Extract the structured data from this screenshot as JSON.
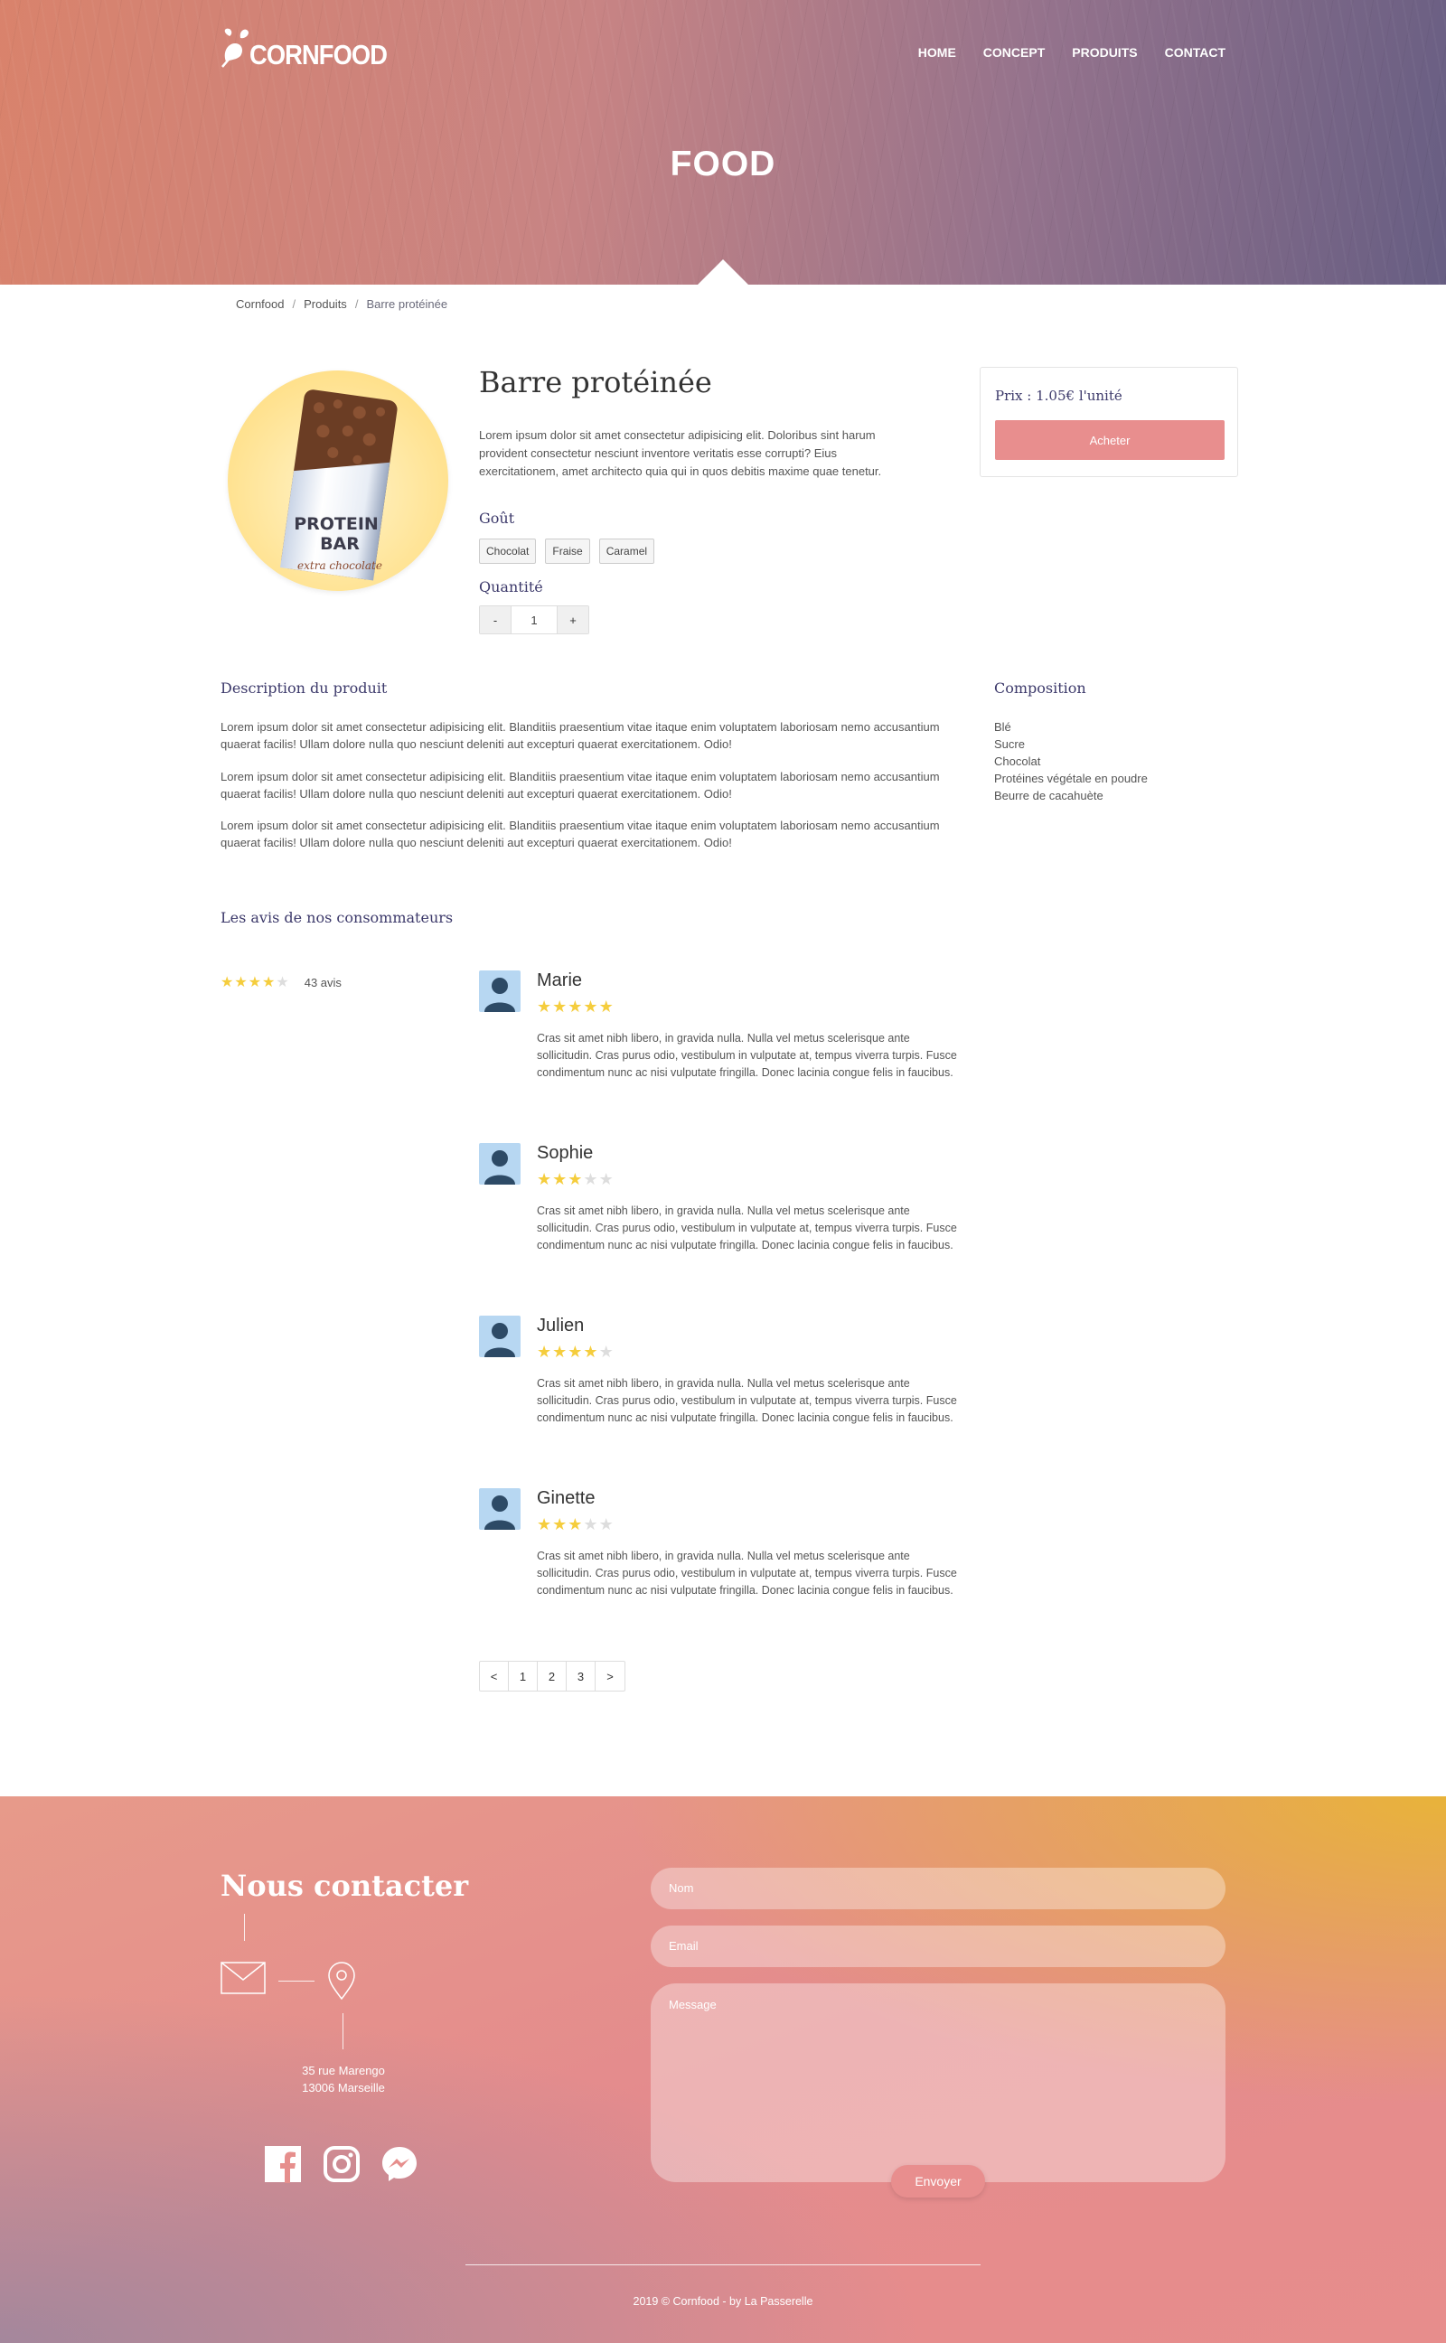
{
  "brand": {
    "logo_text": "CORNFOOD"
  },
  "nav": [
    "HOME",
    "CONCEPT",
    "PRODUITS",
    "CONTACT"
  ],
  "hero": {
    "title": "FOOD"
  },
  "breadcrumb": [
    "Cornfood",
    "Produits",
    "Barre protéinée"
  ],
  "product": {
    "image_text": {
      "line1": "PROTEIN",
      "line2": "BAR",
      "line3": "extra chocolate"
    },
    "title": "Barre protéinée",
    "short_desc": "Lorem ipsum dolor sit amet consectetur adipisicing elit. Doloribus sint harum provident consectetur nesciunt inventore veritatis esse corrupti? Eius exercitationem, amet architecto quia qui in quos debitis maxime quae tenetur.",
    "flavor_label": "Goût",
    "flavors": [
      "Chocolat",
      "Fraise",
      "Caramel"
    ],
    "quantity_label": "Quantité",
    "quantity": {
      "minus": "-",
      "value": "1",
      "plus": "+"
    },
    "price": "Prix : 1.05€ l'unité",
    "buy_label": "Acheter"
  },
  "description": {
    "title": "Description du produit",
    "paragraphs": [
      "Lorem ipsum dolor sit amet consectetur adipisicing elit. Blanditiis praesentium vitae itaque enim voluptatem laboriosam nemo accusantium quaerat facilis! Ullam dolore nulla quo nesciunt deleniti aut excepturi quaerat exercitationem. Odio!",
      "Lorem ipsum dolor sit amet consectetur adipisicing elit. Blanditiis praesentium vitae itaque enim voluptatem laboriosam nemo accusantium quaerat facilis! Ullam dolore nulla quo nesciunt deleniti aut excepturi quaerat exercitationem. Odio!",
      "Lorem ipsum dolor sit amet consectetur adipisicing elit. Blanditiis praesentium vitae itaque enim voluptatem laboriosam nemo accusantium quaerat facilis! Ullam dolore nulla quo nesciunt deleniti aut excepturi quaerat exercitationem. Odio!"
    ]
  },
  "composition": {
    "title": "Composition",
    "items": [
      "Blé",
      "Sucre",
      "Chocolat",
      "Protéines végétale en poudre",
      "Beurre de cacahuète"
    ]
  },
  "reviews": {
    "title": "Les avis de nos consommateurs",
    "average_stars": 4,
    "count_label": "43 avis",
    "star_glyph": "★",
    "items": [
      {
        "name": "Marie",
        "stars": 5,
        "text": "Cras sit amet nibh libero, in gravida nulla. Nulla vel metus scelerisque ante sollicitudin. Cras purus odio, vestibulum in vulputate at, tempus viverra turpis. Fusce condimentum nunc ac nisi vulputate fringilla. Donec lacinia congue felis in faucibus."
      },
      {
        "name": "Sophie",
        "stars": 3,
        "text": "Cras sit amet nibh libero, in gravida nulla. Nulla vel metus scelerisque ante sollicitudin. Cras purus odio, vestibulum in vulputate at, tempus viverra turpis. Fusce condimentum nunc ac nisi vulputate fringilla. Donec lacinia congue felis in faucibus."
      },
      {
        "name": "Julien",
        "stars": 4,
        "text": "Cras sit amet nibh libero, in gravida nulla. Nulla vel metus scelerisque ante sollicitudin. Cras purus odio, vestibulum in vulputate at, tempus viverra turpis. Fusce condimentum nunc ac nisi vulputate fringilla. Donec lacinia congue felis in faucibus."
      },
      {
        "name": "Ginette",
        "stars": 3,
        "text": "Cras sit amet nibh libero, in gravida nulla. Nulla vel metus scelerisque ante sollicitudin. Cras purus odio, vestibulum in vulputate at, tempus viverra turpis. Fusce condimentum nunc ac nisi vulputate fringilla. Donec lacinia congue felis in faucibus."
      }
    ],
    "pagination": [
      "<",
      "1",
      "2",
      "3",
      ">"
    ]
  },
  "contact": {
    "title": "Nous contacter",
    "address_line1": "35 rue Marengo",
    "address_line2": "13006 Marseille",
    "social_icons": [
      "facebook-icon",
      "instagram-icon",
      "messenger-icon"
    ],
    "name_placeholder": "Nom",
    "email_placeholder": "Email",
    "message_placeholder": "Message",
    "send_label": "Envoyer"
  },
  "footer": {
    "copyright": "2019 © Cornfood - by La Passerelle"
  },
  "colors": {
    "accent": "#e88e8e",
    "heading": "#3d3a6b",
    "star": "#f5cd3d"
  }
}
